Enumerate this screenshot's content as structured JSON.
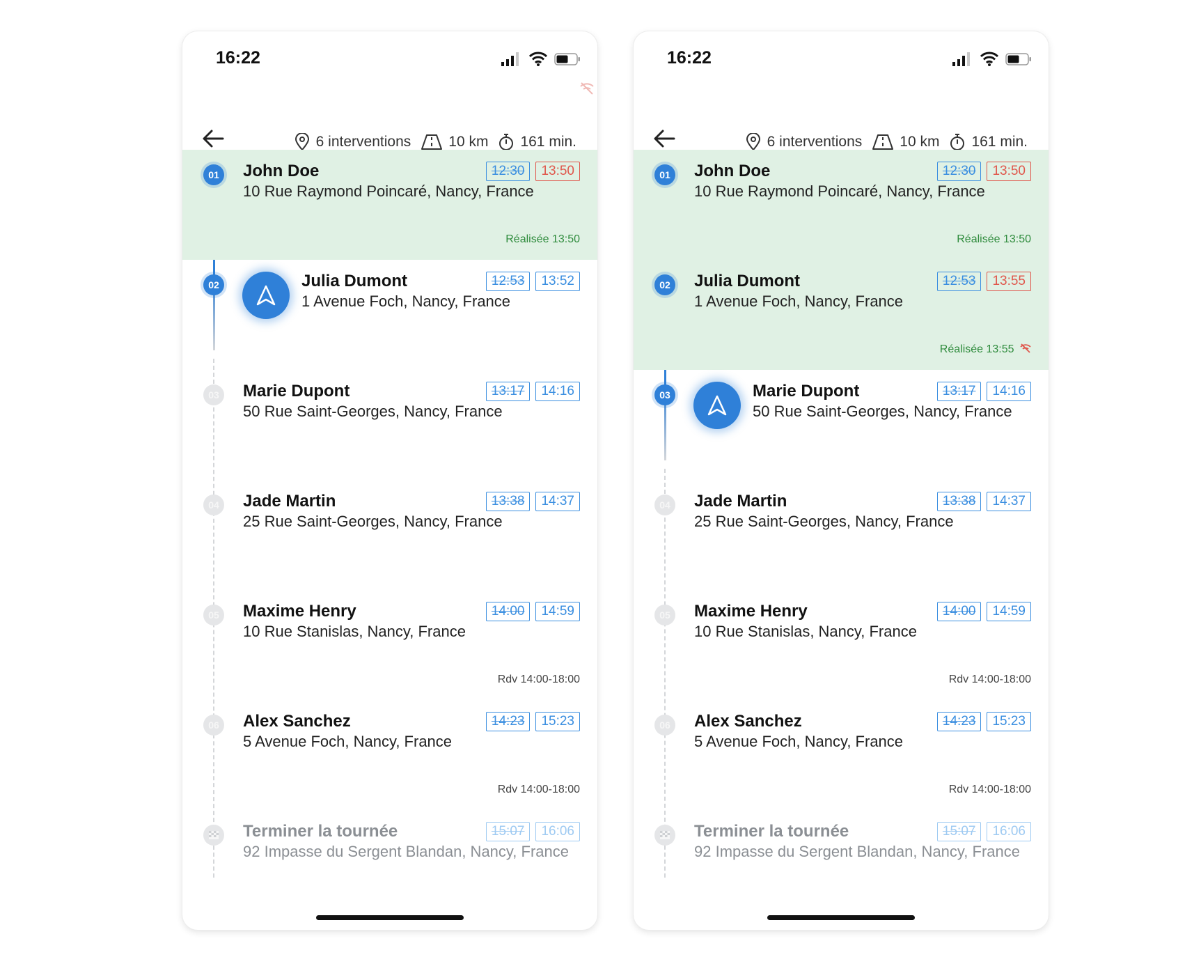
{
  "colors": {
    "accent": "#2f80d8",
    "done_background": "#e0f1e4",
    "late_time": "#e0574c",
    "realised_text": "#2e8b3c",
    "pending_marker": "#e5e6e8"
  },
  "screens": [
    {
      "status_bar": {
        "time": "16:22"
      },
      "summary": {
        "interventions": "6 interventions",
        "distance": "10 km",
        "duration": "161 min."
      },
      "stops": [
        {
          "number": "01",
          "state": "done",
          "name": "John Doe",
          "address": "10 Rue Raymond Poincaré, Nancy, France",
          "planned_time": "12:30",
          "eta": "13:50",
          "eta_late": true,
          "footer": "Réalisée 13:50"
        },
        {
          "number": "02",
          "state": "current",
          "name": "Julia Dumont",
          "address": "1 Avenue Foch, Nancy, France",
          "planned_time": "12:53",
          "eta": "13:52"
        },
        {
          "number": "03",
          "state": "pending",
          "name": "Marie Dupont",
          "address": "50 Rue Saint-Georges, Nancy, France",
          "planned_time": "13:17",
          "eta": "14:16"
        },
        {
          "number": "04",
          "state": "pending",
          "name": "Jade Martin",
          "address": "25 Rue Saint-Georges, Nancy, France",
          "planned_time": "13:38",
          "eta": "14:37"
        },
        {
          "number": "05",
          "state": "pending",
          "name": "Maxime Henry",
          "address": "10 Rue Stanislas, Nancy, France",
          "planned_time": "14:00",
          "eta": "14:59",
          "footer": "Rdv 14:00-18:00"
        },
        {
          "number": "06",
          "state": "pending",
          "name": "Alex Sanchez",
          "address": "5 Avenue Foch, Nancy, France",
          "planned_time": "14:23",
          "eta": "15:23",
          "footer": "Rdv 14:00-18:00"
        }
      ],
      "finish": {
        "name": "Terminer la tournée",
        "address": "92 Impasse du Sergent Blandan, Nancy, France",
        "planned_time": "15:07",
        "eta": "16:06",
        "icon": "flag-icon"
      }
    },
    {
      "status_bar": {
        "time": "16:22"
      },
      "summary": {
        "interventions": "6 interventions",
        "distance": "10 km",
        "duration": "161 min."
      },
      "stops": [
        {
          "number": "01",
          "state": "done",
          "name": "John Doe",
          "address": "10 Rue Raymond Poincaré, Nancy, France",
          "planned_time": "12:30",
          "eta": "13:50",
          "eta_late": true,
          "footer": "Réalisée 13:50"
        },
        {
          "number": "02",
          "state": "done",
          "name": "Julia Dumont",
          "address": "1 Avenue Foch, Nancy, France",
          "planned_time": "12:53",
          "eta": "13:55",
          "eta_late": true,
          "footer": "Réalisée 13:55",
          "offline": true
        },
        {
          "number": "03",
          "state": "current",
          "name": "Marie Dupont",
          "address": "50 Rue Saint-Georges, Nancy, France",
          "planned_time": "13:17",
          "eta": "14:16"
        },
        {
          "number": "04",
          "state": "pending",
          "name": "Jade Martin",
          "address": "25 Rue Saint-Georges, Nancy, France",
          "planned_time": "13:38",
          "eta": "14:37"
        },
        {
          "number": "05",
          "state": "pending",
          "name": "Maxime Henry",
          "address": "10 Rue Stanislas, Nancy, France",
          "planned_time": "14:00",
          "eta": "14:59",
          "footer": "Rdv 14:00-18:00"
        },
        {
          "number": "06",
          "state": "pending",
          "name": "Alex Sanchez",
          "address": "5 Avenue Foch, Nancy, France",
          "planned_time": "14:23",
          "eta": "15:23",
          "footer": "Rdv 14:00-18:00"
        }
      ],
      "finish": {
        "name": "Terminer la tournée",
        "address": "92 Impasse du Sergent Blandan, Nancy, France",
        "planned_time": "15:07",
        "eta": "16:06",
        "icon": "flag-icon"
      }
    }
  ]
}
